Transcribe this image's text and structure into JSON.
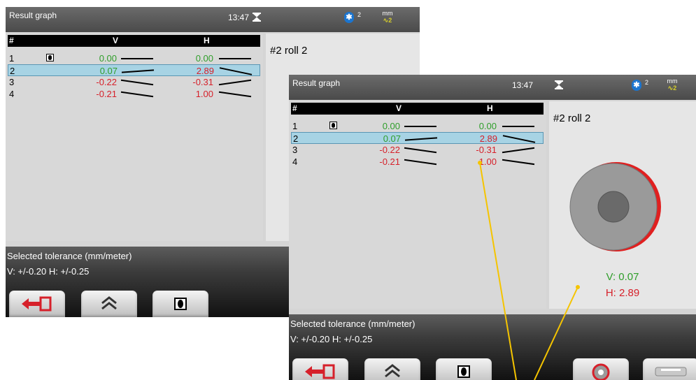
{
  "screens": [
    {
      "title": "Result graph",
      "time": "13:47",
      "bt_count": "2",
      "unit_top": "mm",
      "unit_bottom": "∿2",
      "table": {
        "headers": [
          "#",
          "V",
          "H"
        ],
        "rows": [
          {
            "num": "1",
            "v": "0.00",
            "h": "0.00",
            "v_color": "green",
            "h_color": "green",
            "v_slope": 0,
            "h_slope": 0,
            "ref": true
          },
          {
            "num": "2",
            "v": "0.07",
            "h": "2.89",
            "v_color": "green",
            "h_color": "red",
            "v_slope": -1,
            "h_slope": 3
          },
          {
            "num": "3",
            "v": "-0.22",
            "h": "-0.31",
            "v_color": "red",
            "h_color": "red",
            "v_slope": 2,
            "h_slope": -2
          },
          {
            "num": "4",
            "v": "-0.21",
            "h": "1.00",
            "v_color": "red",
            "h_color": "red",
            "v_slope": 2,
            "h_slope": 2
          }
        ]
      },
      "roll": {
        "title": "#2 roll 2"
      },
      "tolerance": {
        "label": "Selected tolerance (mm/meter)",
        "values": "V: +/-0.20   H: +/-0.25"
      }
    },
    {
      "title": "Result graph",
      "time": "13:47",
      "bt_count": "2",
      "unit_top": "mm",
      "unit_bottom": "∿2",
      "table": {
        "headers": [
          "#",
          "V",
          "H"
        ],
        "rows": [
          {
            "num": "1",
            "v": "0.00",
            "h": "0.00",
            "v_color": "green",
            "h_color": "green",
            "v_slope": 0,
            "h_slope": 0,
            "ref": true
          },
          {
            "num": "2",
            "v": "0.07",
            "h": "2.89",
            "v_color": "green",
            "h_color": "red",
            "v_slope": -1,
            "h_slope": 3
          },
          {
            "num": "3",
            "v": "-0.22",
            "h": "-0.31",
            "v_color": "red",
            "h_color": "red",
            "v_slope": 2,
            "h_slope": -2
          },
          {
            "num": "4",
            "v": "-0.21",
            "h": "1.00",
            "v_color": "red",
            "h_color": "red",
            "v_slope": 2,
            "h_slope": 2
          }
        ]
      },
      "roll": {
        "title": "#2 roll 2",
        "v": "V: 0.07",
        "h": "H: 2.89"
      },
      "tolerance": {
        "label": "Selected tolerance (mm/meter)",
        "values": "V: +/-0.20   H: +/-0.25"
      }
    }
  ],
  "colors": {
    "green": "#2f9e2a",
    "red": "#d6202a",
    "selected_row": "#a7d3e4",
    "leader_line": "#f5c400"
  },
  "icons": {
    "exit": "exit-arrow-icon",
    "up": "double-chevron-up-icon",
    "reference": "reference-square-icon",
    "roll": "roll-view-icon",
    "cylinder": "cylinder-view-icon",
    "time": "hourglass-icon",
    "bluetooth": "bluetooth-icon"
  }
}
